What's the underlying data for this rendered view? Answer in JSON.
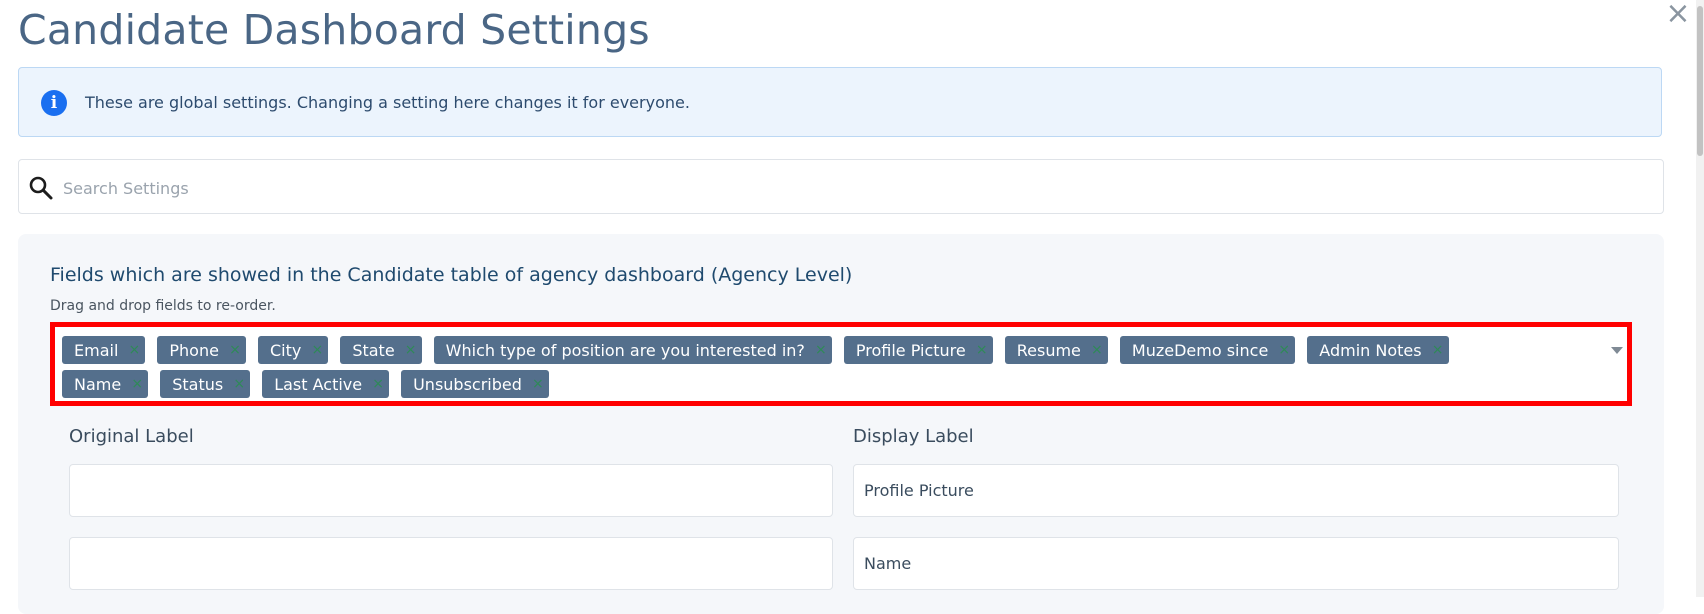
{
  "page": {
    "title": "Candidate Dashboard Settings"
  },
  "alert": {
    "icon": "info-icon",
    "text": "These are global settings. Changing a setting here changes it for everyone."
  },
  "search": {
    "placeholder": "Search Settings",
    "value": ""
  },
  "fields_panel": {
    "heading": "Fields which are showed in the Candidate table of agency dashboard (Agency Level)",
    "hint": "Drag and drop fields to re-order.",
    "tags_row1": [
      "Email",
      "Phone",
      "City",
      "State",
      "Which type of position are you interested in?",
      "Profile Picture",
      "Resume",
      "MuzeDemo since",
      "Admin Notes"
    ],
    "tags_row2": [
      "Name",
      "Status",
      "Last Active",
      "Unsubscribed"
    ],
    "remove_glyph": "×",
    "highlight_color": "#ff0000"
  },
  "labels": {
    "original_header": "Original Label",
    "display_header": "Display Label",
    "rows": [
      {
        "original": "",
        "display": "Profile Picture"
      },
      {
        "original": "",
        "display": "Name"
      }
    ]
  },
  "colors": {
    "tag_bg": "#546f8c",
    "alert_bg": "#ecf4fd",
    "info_icon": "#1a6ff0",
    "title": "#4a6685"
  }
}
